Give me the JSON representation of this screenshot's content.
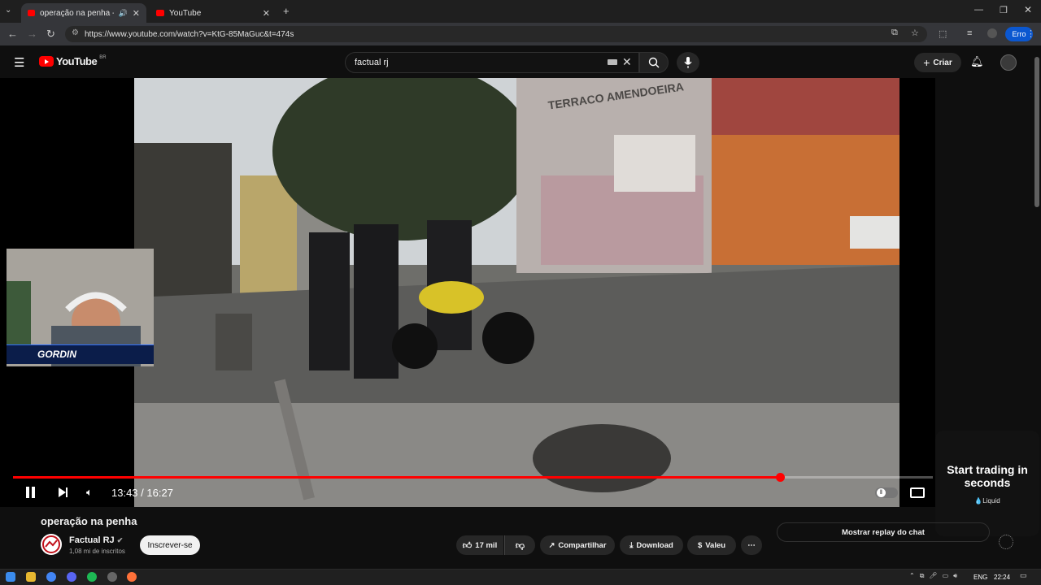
{
  "browser": {
    "tabs": [
      {
        "title": "operação na penha - YouTu"
      },
      {
        "title": "YouTube"
      }
    ],
    "url": "https://www.youtube.com/watch?v=KtG-85MaGuc&t=474s",
    "profile_label": "Erro"
  },
  "youtube": {
    "logo": "YouTube",
    "region": "BR",
    "search_value": "factual rj",
    "create_label": "Criar"
  },
  "video": {
    "sign_text": "TERRACO AMENDOEIRA",
    "time_current": "13:43",
    "time_total": "16:27",
    "progress": 0.834,
    "overlay_name": "GORDIN"
  },
  "ad": {
    "headline": "Start trading in seconds",
    "brand": "Liquid"
  },
  "meta": {
    "title": "operação na penha",
    "channel": "Factual RJ",
    "subscribers": "1,08 mi de inscritos",
    "subscribe_label": "Inscrever-se",
    "likes": "17 mil",
    "share_label": "Compartilhar",
    "download_label": "Download",
    "thanks_label": "Valeu",
    "chat_replay_label": "Mostrar replay do chat"
  },
  "taskbar": {
    "lang": "ENG",
    "time": "22:24"
  },
  "colors": {
    "accent": "#ff0000",
    "bg": "#0f0f0f"
  }
}
